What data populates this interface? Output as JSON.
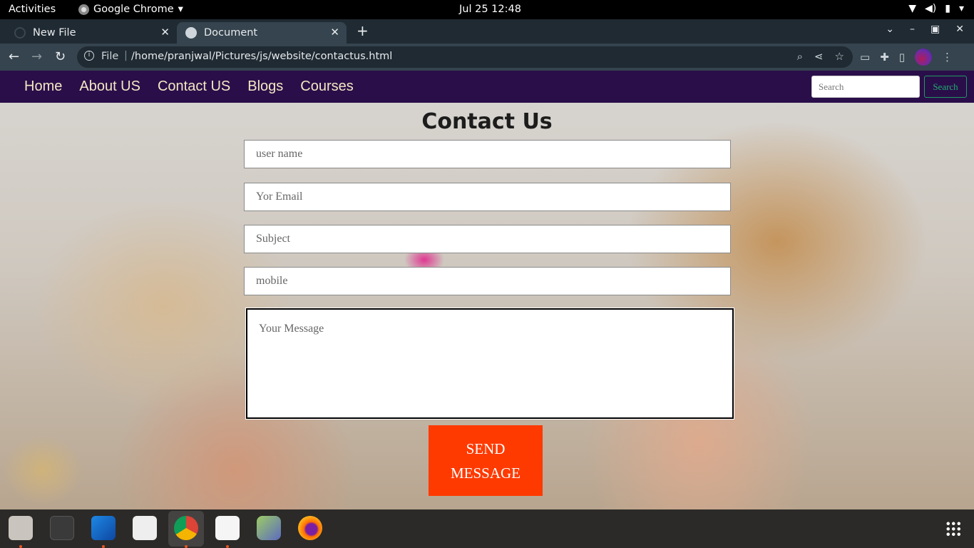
{
  "system_bar": {
    "activities": "Activities",
    "app_name": "Google Chrome",
    "datetime": "Jul 25  12:48"
  },
  "browser": {
    "tabs": [
      {
        "title": "New File",
        "active": false
      },
      {
        "title": "Document",
        "active": true
      }
    ],
    "address": {
      "scheme_label": "File",
      "url": "/home/pranjwal/Pictures/js/website/contactus.html"
    }
  },
  "page": {
    "nav_links": [
      "Home",
      "About US",
      "Contact US",
      "Blogs",
      "Courses"
    ],
    "search": {
      "placeholder": "Search",
      "button": "Search"
    },
    "title": "Contact Us",
    "form": {
      "username_placeholder": "user name",
      "email_placeholder": "Yor Email",
      "subject_placeholder": "Subject",
      "mobile_placeholder": "mobile",
      "message_placeholder": "Your Message",
      "send_label": "SEND MESSAGE"
    }
  },
  "colors": {
    "navbar_bg": "#2a0e4a",
    "nav_link": "#f4e7c3",
    "send_button": "#ff3a00",
    "search_button_border": "#1f9b63"
  },
  "dock": {
    "apps": [
      "files-icon",
      "terminal-icon",
      "vscode-icon",
      "document-viewer-icon",
      "chrome-icon",
      "text-editor-icon",
      "app-icon",
      "firefox-icon"
    ]
  }
}
